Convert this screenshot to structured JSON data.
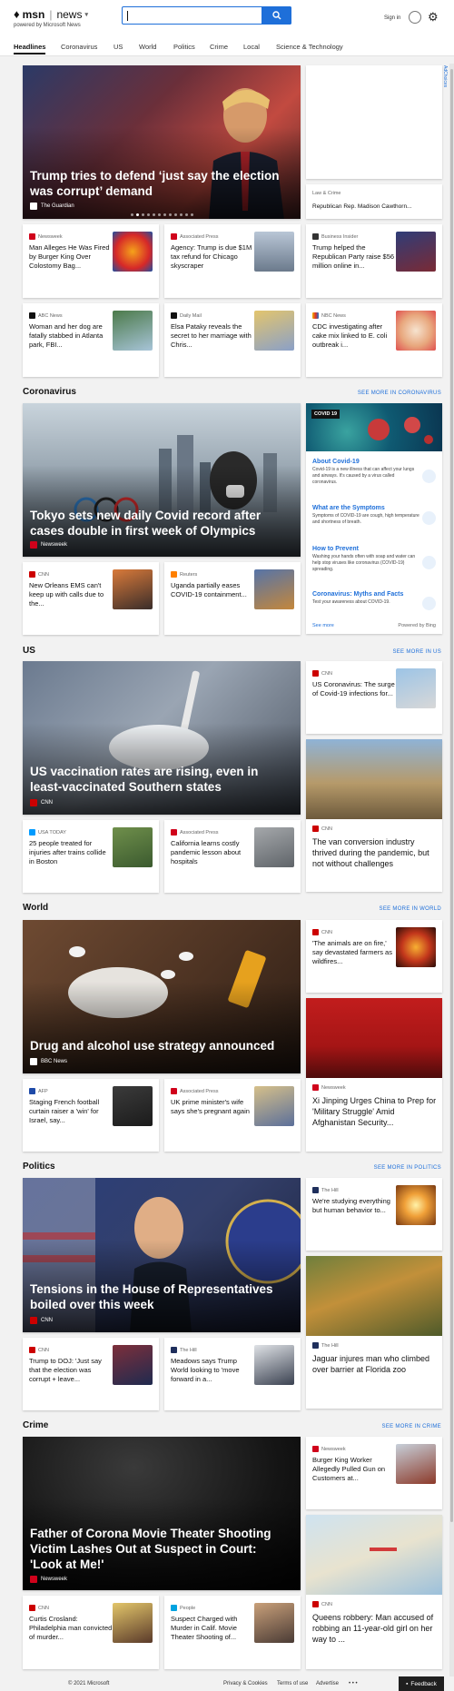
{
  "header": {
    "logo_text": "msn",
    "section_text": "news",
    "powered_by": "powered by Microsoft News",
    "signin_label": "Sign in"
  },
  "nav": {
    "tabs": [
      "Headlines",
      "Coronavirus",
      "US",
      "World",
      "Politics",
      "Crime",
      "Local",
      "Science & Technology"
    ],
    "active": "Headlines"
  },
  "adchoices": "AdChoices",
  "headlines": {
    "hero": {
      "title": "Trump tries to defend ‘just say the election was corrupt’ demand",
      "source": "The Guardian"
    },
    "side_top": {
      "title": ""
    },
    "side_small": {
      "category": "Law & Crime",
      "title": "Republican Rep. Madison Cawthorn..."
    },
    "cards": [
      {
        "source": "Newsweek",
        "title": "Man Alleges He Was Fired by Burger King Over Colostomy Bag..."
      },
      {
        "source": "Associated Press",
        "title": "Agency: Trump is due $1M tax refund for Chicago skyscraper"
      },
      {
        "source": "Business Insider",
        "title": "Trump helped the Republican Party raise $56 million online in..."
      },
      {
        "source": "ABC News",
        "title": "Woman and her dog are fatally stabbed in Atlanta park, FBI..."
      },
      {
        "source": "Daily Mail",
        "title": "Elsa Pataky reveals the secret to her marriage with Chris..."
      },
      {
        "source": "NBC News",
        "title": "CDC investigating after cake mix linked to E. coli outbreak i..."
      }
    ]
  },
  "coronavirus": {
    "heading": "Coronavirus",
    "see_more": "SEE MORE IN CORONAVIRUS",
    "hero": {
      "title": "Tokyo sets new daily Covid record after cases double in first week of Olympics",
      "source": "Newsweek"
    },
    "cards": [
      {
        "source": "CNN",
        "title": "New Orleans EMS can't keep up with calls due to the..."
      },
      {
        "source": "Reuters",
        "title": "Uganda partially eases COVID-19 containment..."
      }
    ],
    "panel": {
      "tag": "COVID 19",
      "items": [
        {
          "heading": "About Covid-19",
          "text": "Covid-19 is a new illness that can affect your lungs and airways. It's caused by a virus called coronavirus."
        },
        {
          "heading": "What are the Symptoms",
          "text": "Symptoms of COVID-19 are cough, high temperature and shortness of breath."
        },
        {
          "heading": "How to Prevent",
          "text": "Washing your hands often with soap and water can help stop viruses like coronavirus (COVID-19) spreading."
        },
        {
          "heading": "Coronavirus: Myths and Facts",
          "text": "Test your awareness about COVID-19."
        }
      ],
      "see_more": "See more",
      "powered": "Powered by Bing"
    }
  },
  "us": {
    "heading": "US",
    "see_more": "SEE MORE IN US",
    "hero": {
      "title": "US vaccination rates are rising, even in least-vaccinated Southern states",
      "source": "CNN"
    },
    "side_small": {
      "source": "CNN",
      "title": "US Coronavirus: The surge of Covid-19 infections for..."
    },
    "side_tall": {
      "source": "CNN",
      "title": "The van conversion industry thrived during the pandemic, but not without challenges"
    },
    "cards": [
      {
        "source": "USA TODAY",
        "title": "25 people treated for injuries after trains collide in Boston"
      },
      {
        "source": "Associated Press",
        "title": "California learns costly pandemic lesson about hospitals"
      }
    ]
  },
  "world": {
    "heading": "World",
    "see_more": "SEE MORE IN WORLD",
    "hero": {
      "title": "Drug and alcohol use strategy announced",
      "source": "BBC News"
    },
    "side_small": {
      "source": "CNN",
      "title": "'The animals are on fire,' say devastated farmers as wildfires..."
    },
    "side_tall": {
      "source": "Newsweek",
      "title": "Xi Jinping Urges China to Prep for 'Military Struggle' Amid Afghanistan Security..."
    },
    "cards": [
      {
        "source": "AFP",
        "title": "Staging French football curtain raiser a 'win' for Israel, say..."
      },
      {
        "source": "Associated Press",
        "title": "UK prime minister's wife says she's pregnant again"
      }
    ]
  },
  "politics": {
    "heading": "Politics",
    "see_more": "SEE MORE IN POLITICS",
    "hero": {
      "title": "Tensions in the House of Representatives boiled over this week",
      "source": "CNN"
    },
    "side_small": {
      "source": "The Hill",
      "title": "We're studying everything but human behavior to..."
    },
    "side_tall": {
      "source": "The Hill",
      "title": "Jaguar injures man who climbed over barrier at Florida zoo"
    },
    "cards": [
      {
        "source": "CNN",
        "title": "Trump to DOJ: 'Just say that the election was corrupt + leave..."
      },
      {
        "source": "The Hill",
        "title": "Meadows says Trump World looking to 'move forward in a..."
      }
    ]
  },
  "crime": {
    "heading": "Crime",
    "see_more": "SEE MORE IN CRIME",
    "hero": {
      "title": "Father of Corona Movie Theater Shooting Victim Lashes Out at Suspect in Court: 'Look at Me!'",
      "source": "Newsweek"
    },
    "side_small": {
      "source": "Newsweek",
      "title": "Burger King Worker Allegedly Pulled Gun on Customers at..."
    },
    "side_tall": {
      "source": "CNN",
      "title": "Queens robbery: Man accused of robbing an 11-year-old girl on her way to ..."
    },
    "cards": [
      {
        "source": "CNN",
        "title": "Curtis Crosland: Philadelphia man convicted of murder..."
      },
      {
        "source": "People",
        "title": "Suspect Charged with Murder in Calif. Movie Theater Shooting of..."
      }
    ]
  },
  "footer": {
    "copyright": "© 2021 Microsoft",
    "links": [
      "Privacy & Cookies",
      "Terms of use",
      "Advertise"
    ],
    "more": "• • •",
    "feedback": "Feedback"
  },
  "colors": {
    "accent": "#1e6fd9",
    "cnn": "#cc0000",
    "newsweek": "#d0021b",
    "ap": "#d0021b",
    "usatoday": "#009bff"
  }
}
